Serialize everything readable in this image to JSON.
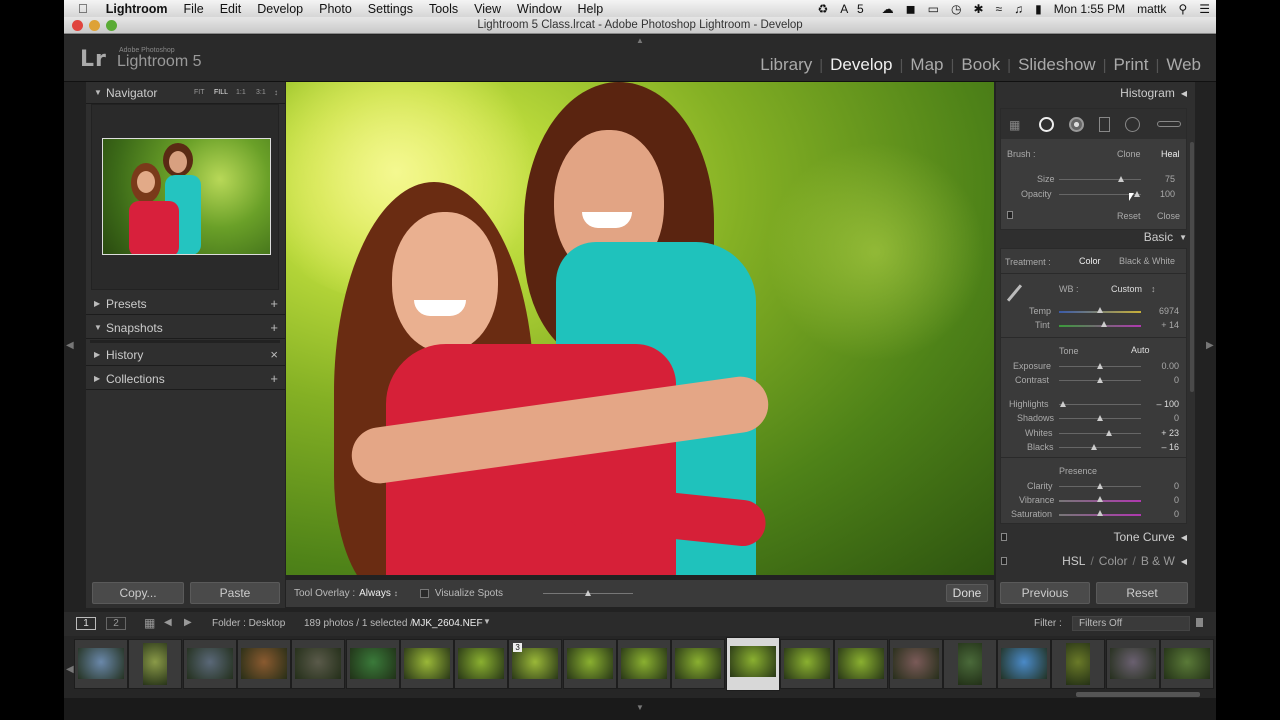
{
  "menubar": {
    "app_name": "Lightroom",
    "items": [
      "File",
      "Edit",
      "Develop",
      "Photo",
      "Settings",
      "Tools",
      "View",
      "Window",
      "Help"
    ],
    "status": {
      "adobe_badge": "5",
      "clock": "Mon 1:55 PM",
      "user": "mattk"
    }
  },
  "window": {
    "title": "Lightroom 5 Class.lrcat - Adobe Photoshop Lightroom - Develop"
  },
  "identity": {
    "logo": "Lr",
    "adobe": "Adobe Photoshop",
    "product": "Lightroom 5"
  },
  "modules": [
    {
      "label": "Library",
      "active": false
    },
    {
      "label": "Develop",
      "active": true
    },
    {
      "label": "Map",
      "active": false
    },
    {
      "label": "Book",
      "active": false
    },
    {
      "label": "Slideshow",
      "active": false
    },
    {
      "label": "Print",
      "active": false
    },
    {
      "label": "Web",
      "active": false
    }
  ],
  "left_panel": {
    "navigator": {
      "title": "Navigator",
      "zoom": [
        "FIT",
        "FILL",
        "1:1",
        "3:1"
      ]
    },
    "presets": "Presets",
    "snapshots": "Snapshots",
    "history": "History",
    "collections": "Collections",
    "copy_button": "Copy...",
    "paste_button": "Paste"
  },
  "toolbar": {
    "overlay_label": "Tool Overlay :",
    "overlay_value": "Always",
    "visualize_label": "Visualize Spots",
    "done_button": "Done"
  },
  "right_panel": {
    "histogram": "Histogram",
    "brush": {
      "label": "Brush :",
      "clone": "Clone",
      "heal": "Heal",
      "size_label": "Size",
      "size_value": "75",
      "size_pos": 0.75,
      "opacity_label": "Opacity",
      "opacity_value": "100",
      "opacity_pos": 0.95,
      "reset": "Reset",
      "close": "Close"
    },
    "basic": {
      "title": "Basic",
      "treatment_label": "Treatment :",
      "color": "Color",
      "bw": "Black & White",
      "wb_label": "WB :",
      "wb_value": "Custom",
      "temp": {
        "label": "Temp",
        "value": "6974",
        "pos": 0.5
      },
      "tint": {
        "label": "Tint",
        "value": "+ 14",
        "pos": 0.55
      },
      "tone_label": "Tone",
      "auto": "Auto",
      "exposure": {
        "label": "Exposure",
        "value": "0.00",
        "pos": 0.5
      },
      "contrast": {
        "label": "Contrast",
        "value": "0",
        "pos": 0.5
      },
      "highlights": {
        "label": "Highlights",
        "value": "– 100",
        "pos": 0.05
      },
      "shadows": {
        "label": "Shadows",
        "value": "0",
        "pos": 0.5
      },
      "whites": {
        "label": "Whites",
        "value": "+ 23",
        "pos": 0.61
      },
      "blacks": {
        "label": "Blacks",
        "value": "– 16",
        "pos": 0.43
      },
      "presence_label": "Presence",
      "clarity": {
        "label": "Clarity",
        "value": "0",
        "pos": 0.5
      },
      "vibrance": {
        "label": "Vibrance",
        "value": "0",
        "pos": 0.5
      },
      "saturation": {
        "label": "Saturation",
        "value": "0",
        "pos": 0.5
      }
    },
    "tone_curve": "Tone Curve",
    "hsl": {
      "hsl": "HSL",
      "color": "Color",
      "bw": "B & W"
    },
    "previous_button": "Previous",
    "reset_button": "Reset"
  },
  "filmstrip_bar": {
    "page1": "1",
    "page2": "2",
    "folder": "Folder : Desktop",
    "count": "189 photos / 1 selected /",
    "filename": "MJK_2604.NEF",
    "filter_label": "Filter :",
    "filter_value": "Filters Off"
  },
  "filmstrip": {
    "badge": "3",
    "thumbs": [
      "#6a88aa",
      "#8a9a48",
      "#5a6878",
      "#8a5a30",
      "#5a5a4a",
      "#3a7a3a",
      "#9ab838",
      "#8ab030",
      "#9ab838",
      "#8ab030",
      "#8ab030",
      "#8ab030",
      "#8ab030",
      "#8ab030",
      "#8ab030",
      "#7a5a58",
      "#4a6a3a",
      "#4a8ac8",
      "#6a7a28",
      "#6a6070",
      "#5a7a38"
    ],
    "selected_index": 12
  }
}
